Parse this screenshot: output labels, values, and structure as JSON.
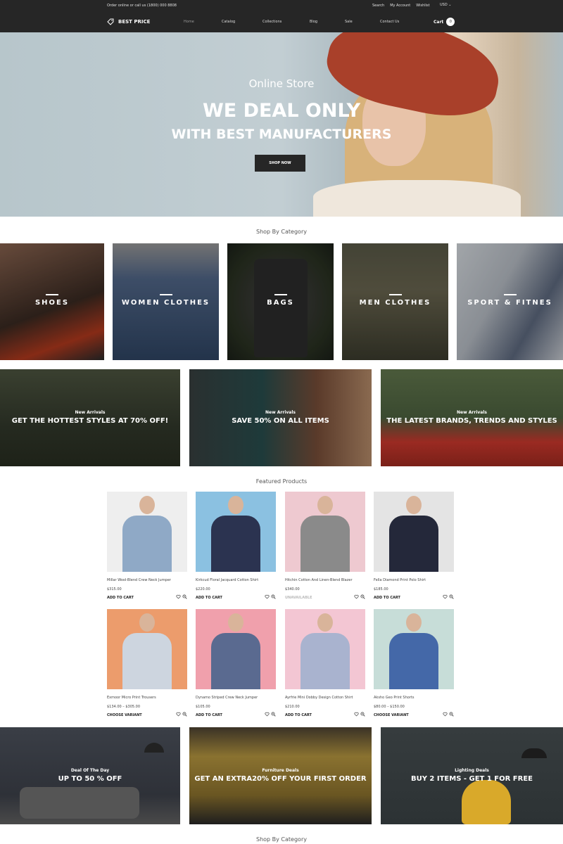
{
  "topbar": {
    "phone_text": "Order online or call us (1800) 000 8808",
    "links": [
      "Search",
      "My Account",
      "Wishlist"
    ],
    "currency": "USD",
    "currency_icon": "chevron-down-icon"
  },
  "header": {
    "logo_text": "BEST PRICE",
    "logo_icon": "price-tag-icon",
    "nav": [
      "Home",
      "Catalog",
      "Collections",
      "Blog",
      "Sale",
      "Contact Us"
    ],
    "active_nav": "Home",
    "cart_label": "Cart",
    "cart_count": "0"
  },
  "hero": {
    "subtitle": "Online Store",
    "title_line1": "WE DEAL ONLY",
    "title_line2": "WITH BEST MANUFACTURERS",
    "button_label": "SHOP NOW"
  },
  "categories_section": {
    "title": "Shop By Category",
    "items": [
      {
        "label": "SHOES",
        "color": "#6a3a2a"
      },
      {
        "label": "WOMEN CLOTHES",
        "color": "#3f5470"
      },
      {
        "label": "BAGS",
        "color": "#2c2f2a"
      },
      {
        "label": "MEN CLOTHES",
        "color": "#4a4c3a"
      },
      {
        "label": "SPORT & FITNES",
        "color": "#8a8e96"
      }
    ]
  },
  "promos": [
    {
      "kicker": "New Arrivals",
      "headline": "GET THE HOTTEST STYLES AT 70% OFF!",
      "color": "#2a3024"
    },
    {
      "kicker": "New Arrivals",
      "headline": "SAVE 50% ON ALL ITEMS",
      "color": "#3a2c26"
    },
    {
      "kicker": "New Arrivals",
      "headline": "THE LATEST BRANDS, TRENDS AND STYLES",
      "color": "#4a5a3a"
    }
  ],
  "featured": {
    "title": "Featured Products",
    "products": [
      {
        "name": "Millar Wool-Blend Crew Neck Jumper",
        "price": "$315.00",
        "action": "ADD TO CART",
        "available": true,
        "bg": "#eeeeee",
        "garment": "#8fa9c6"
      },
      {
        "name": "Kirkcud Floral Jacquard Cotton Shirt",
        "price": "$220.00",
        "action": "ADD TO CART",
        "available": true,
        "bg": "#8bc1e1",
        "garment": "#2b3350"
      },
      {
        "name": "Hitchin Cotton And Linen-Blend Blazer",
        "price": "$340.00",
        "action": "UNAVAILABLE",
        "available": false,
        "bg": "#eec9d0",
        "garment": "#8a8a8a"
      },
      {
        "name": "Fella Diamond Print Polo Shirt",
        "price": "$185.00",
        "action": "ADD TO CART",
        "available": true,
        "bg": "#e4e4e4",
        "garment": "#24283a"
      },
      {
        "name": "Exmoor Micro Print Trousers",
        "price": "$134.00 – $305.00",
        "action": "CHOOSE VARIANT",
        "available": true,
        "bg": "#ec9c6c",
        "garment": "#cdd5df"
      },
      {
        "name": "Dynamo Striped Crew Neck Jumper",
        "price": "$105.00",
        "action": "ADD TO CART",
        "available": true,
        "bg": "#f0a0ac",
        "garment": "#5a6a90"
      },
      {
        "name": "Ayrfrie Mini Dobby Design Cotton Shirt",
        "price": "$210.00",
        "action": "ADD TO CART",
        "available": true,
        "bg": "#f3c6d3",
        "garment": "#a9b3cf"
      },
      {
        "name": "Aksho Geo Print Shorts",
        "price": "$80.00 – $150.00",
        "action": "CHOOSE VARIANT",
        "available": true,
        "bg": "#c7ddd8",
        "garment": "#4468a8"
      }
    ]
  },
  "deals": [
    {
      "kicker": "Deal Of The Day",
      "headline": "UP TO 50 % OFF",
      "color": "#33363d"
    },
    {
      "kicker": "Furniture Deals",
      "headline": "GET AN EXTRA20% OFF YOUR FIRST ORDER",
      "color": "#7a6427"
    },
    {
      "kicker": "Lighting Deals",
      "headline": "BUY 2 ITEMS - GET 1 FOR FREE",
      "color": "#2f3536"
    }
  ],
  "bottom_section": {
    "title": "Shop By Category"
  }
}
